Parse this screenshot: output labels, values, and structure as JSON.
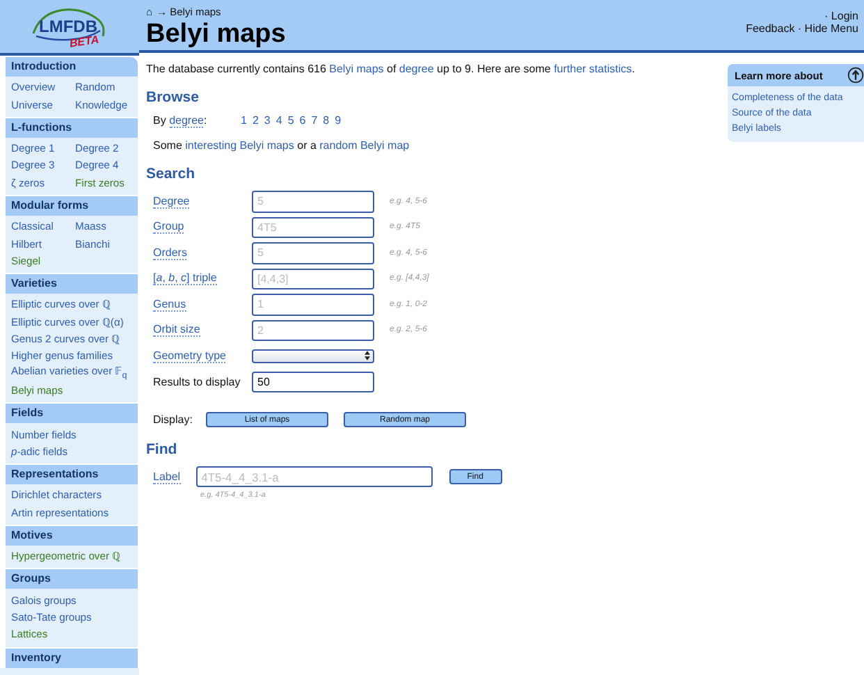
{
  "logo": {
    "name": "LMFDB",
    "badge": "BETA"
  },
  "sidebar": [
    {
      "heading": "Introduction",
      "rows": [
        [
          {
            "label": "Overview",
            "color": "#2f5fb3"
          },
          {
            "label": "Random",
            "color": "#2f5fb3"
          }
        ],
        [
          {
            "label": "Universe",
            "color": "#2f5fb3"
          },
          {
            "label": "Knowledge",
            "color": "#2f5fb3"
          }
        ]
      ]
    },
    {
      "heading": "L-functions",
      "rows": [
        [
          {
            "label": "Degree 1",
            "color": "#2f5fb3"
          },
          {
            "label": "Degree 2",
            "color": "#2f5fb3"
          }
        ],
        [
          {
            "label": "Degree 3",
            "color": "#2f5fb3"
          },
          {
            "label": "Degree 4",
            "color": "#2f5fb3"
          }
        ],
        [
          {
            "label": "ζ zeros",
            "color": "#2f5fb3"
          },
          {
            "label": "First zeros",
            "color": "#3b7d23"
          }
        ]
      ]
    },
    {
      "heading": "Modular forms",
      "rows": [
        [
          {
            "label": "Classical",
            "color": "#2f5fb3"
          },
          {
            "label": "Maass",
            "color": "#2f5fb3"
          }
        ],
        [
          {
            "label": "Hilbert",
            "color": "#2f5fb3"
          },
          {
            "label": "Bianchi",
            "color": "#2f5fb3"
          }
        ],
        [
          {
            "label": "Siegel",
            "color": "#3b7d23"
          }
        ]
      ]
    },
    {
      "heading": "Varieties",
      "rows": [
        [
          {
            "label": "Elliptic curves over ℚ",
            "color": "#2f5fb3"
          }
        ],
        [
          {
            "label": "Elliptic curves over ℚ(α)",
            "color": "#2f5fb3"
          }
        ],
        [
          {
            "label": "Genus 2 curves over ℚ",
            "color": "#2f5fb3"
          }
        ],
        [
          {
            "label": "Higher genus families",
            "color": "#2f5fb3"
          }
        ],
        [
          {
            "label": "Abelian varieties over 𝔽$_{q}$",
            "color": "#2f5fb3"
          }
        ],
        [
          {
            "label": "Belyi maps",
            "color": "#3b7d23"
          }
        ]
      ]
    },
    {
      "heading": "Fields",
      "rows": [
        [
          {
            "label": "Number fields",
            "color": "#2f5fb3"
          }
        ],
        [
          {
            "label": "*p*-adic fields",
            "color": "#2f5fb3"
          }
        ]
      ]
    },
    {
      "heading": "Representations",
      "rows": [
        [
          {
            "label": "Dirichlet characters",
            "color": "#2f5fb3"
          }
        ],
        [
          {
            "label": "Artin representations",
            "color": "#2f5fb3"
          }
        ]
      ]
    },
    {
      "heading": "Motives",
      "rows": [
        [
          {
            "label": "Hypergeometric over ℚ",
            "color": "#3b7d23"
          }
        ]
      ]
    },
    {
      "heading": "Groups",
      "rows": [
        [
          {
            "label": "Galois groups",
            "color": "#2f5fb3"
          }
        ],
        [
          {
            "label": "Sato-Tate groups",
            "color": "#2f5fb3"
          }
        ],
        [
          {
            "label": "Lattices",
            "color": "#3b7d23"
          }
        ]
      ]
    },
    {
      "heading": "Inventory"
    }
  ],
  "header": {
    "breadcrumb_home": "⌂",
    "breadcrumb": "→ Belyi maps",
    "title": "Belyi maps",
    "login": "· Login",
    "menu": "Feedback · Hide Menu"
  },
  "intro": [
    {
      "kind": "text",
      "text": "The database currently contains 616 "
    },
    {
      "kind": "link",
      "text": "Belyi maps"
    },
    {
      "kind": "text",
      "text": " of "
    },
    {
      "kind": "link",
      "text": "degree"
    },
    {
      "kind": "text",
      "text": " up to 9. Here are some "
    },
    {
      "kind": "link",
      "text": "further statistics"
    },
    {
      "kind": "text",
      "text": "."
    }
  ],
  "browse": {
    "heading": "Browse",
    "by": "By",
    "by_link": "degree",
    "colon": ":",
    "degrees": [
      "1",
      "2",
      "3",
      "4",
      "5",
      "6",
      "7",
      "8",
      "9"
    ],
    "some": [
      {
        "kind": "text",
        "text": "Some "
      },
      {
        "kind": "link",
        "text": "interesting Belyi maps"
      },
      {
        "kind": "text",
        "text": " or a "
      },
      {
        "kind": "link",
        "text": "random Belyi map"
      }
    ]
  },
  "search": {
    "heading": "Search",
    "fields": [
      {
        "kind": "input",
        "label": "Degree",
        "label_link": true,
        "placeholder": "5",
        "example": "e.g. 4, 5-6"
      },
      {
        "kind": "input",
        "label": "Group",
        "label_link": true,
        "placeholder": "4T5",
        "example": "e.g. 4T5"
      },
      {
        "kind": "input",
        "label": "Orders",
        "label_link": true,
        "placeholder": "5",
        "example": "e.g. 4, 5-6"
      },
      {
        "kind": "input",
        "label": "[*a*, *b*, *c*] triple",
        "label_link": true,
        "placeholder": "[4,4,3]",
        "example": "e.g. [4,4,3]"
      },
      {
        "kind": "input",
        "label": "Genus",
        "label_link": true,
        "placeholder": "1",
        "example": "e.g. 1, 0-2"
      },
      {
        "kind": "input",
        "label": "Orbit size",
        "label_link": true,
        "placeholder": "2",
        "example": "e.g. 2, 5-6"
      },
      {
        "kind": "select",
        "label": "Geometry type",
        "label_link": true
      },
      {
        "kind": "input",
        "label": "Results to display",
        "label_link": false,
        "value": "50"
      }
    ],
    "display_label": "Display:",
    "buttons": [
      "List of maps",
      "Random map"
    ]
  },
  "find": {
    "heading": "Find",
    "label": "Label",
    "placeholder": "4T5-4_4_3.1-a",
    "button": "Find",
    "example": "e.g. 4T5-4_4_3.1-a"
  },
  "learn_more": {
    "title": "Learn more about",
    "links": [
      "Completeness of the data",
      "Source of the data",
      "Belyi labels"
    ]
  }
}
